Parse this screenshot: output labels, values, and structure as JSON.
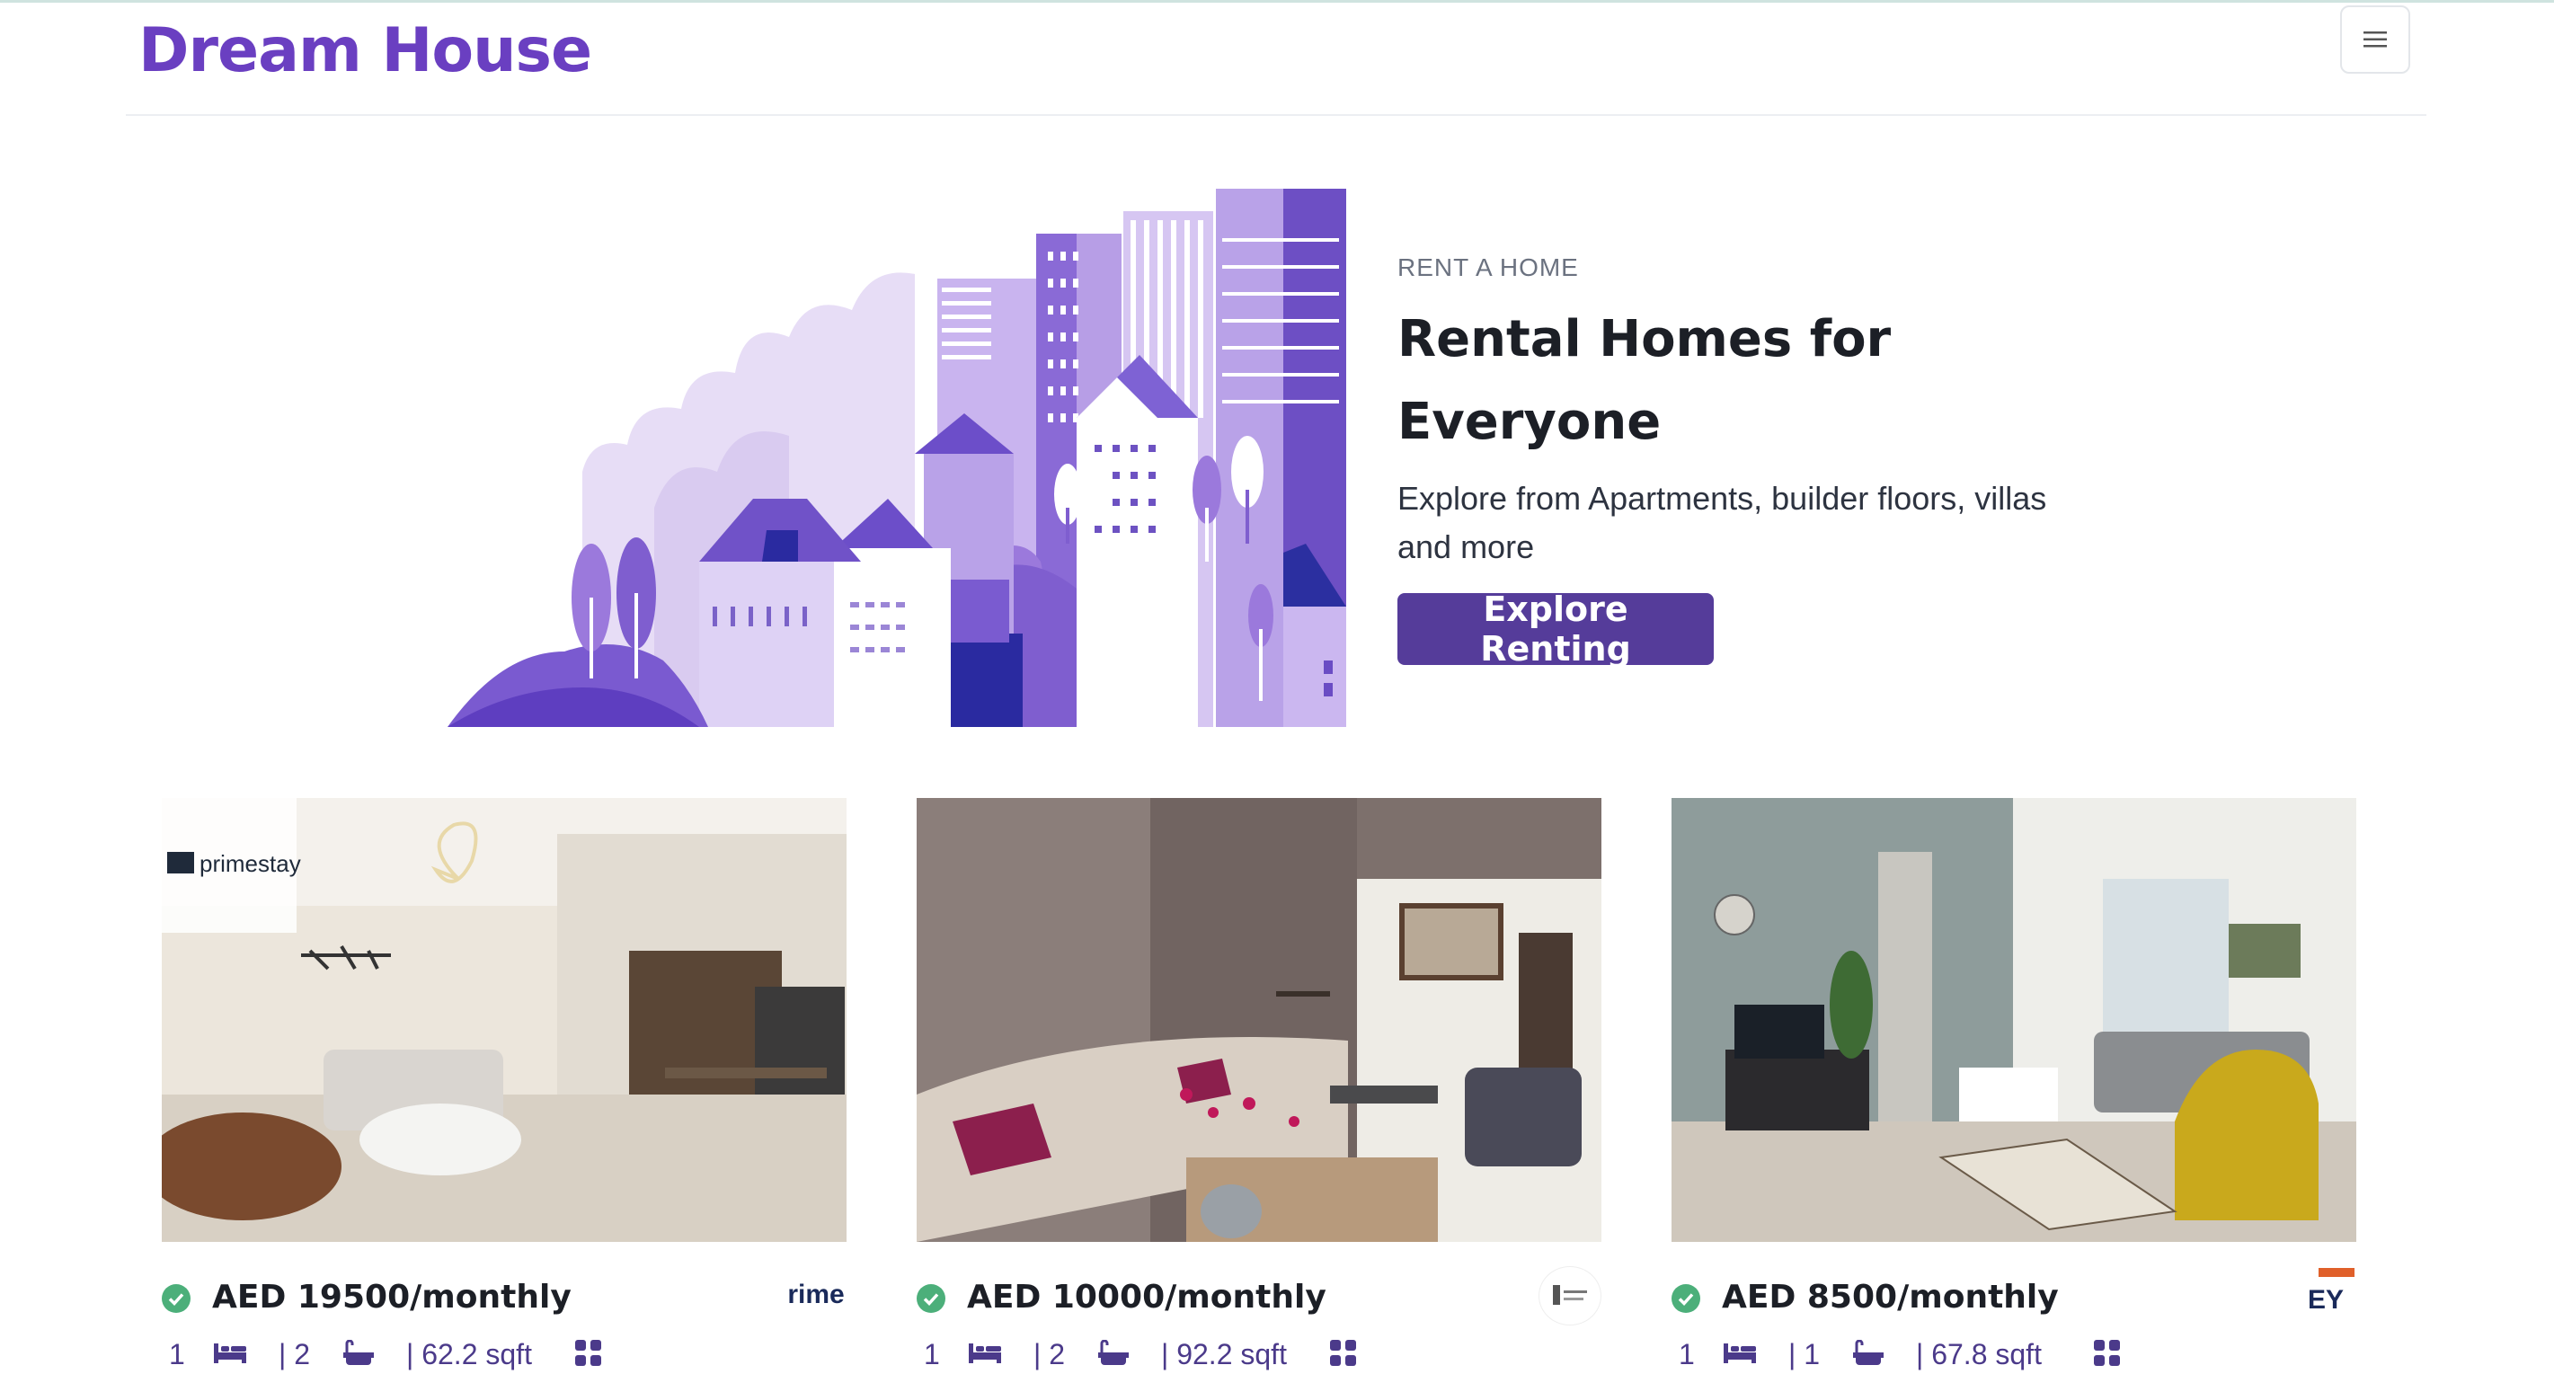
{
  "brand": "Dream House",
  "menu_icon": "hamburger-icon",
  "hero": {
    "eyebrow": "RENT A HOME",
    "title_line1": "Rental Homes for",
    "title_line2": "Everyone",
    "subtitle": "Explore from Apartments, builder floors, villas and more",
    "cta": "Explore Renting"
  },
  "colors": {
    "brand": "#6a3fc1",
    "cta": "#553c9a",
    "verified": "#4caf7a",
    "spec": "#4b3a8a"
  },
  "listings": [
    {
      "price": "AED 19500/monthly",
      "agent_logo_text": "rime",
      "photo_watermark": "primestay",
      "beds": "1",
      "baths": "| 2",
      "area": "| 62.2 sqft"
    },
    {
      "price": "AED 10000/monthly",
      "agent_logo_text": "",
      "photo_watermark": "",
      "beds": "1",
      "baths": "| 2",
      "area": "| 92.2 sqft"
    },
    {
      "price": "AED 8500/monthly",
      "agent_logo_text": "EY",
      "photo_watermark": "",
      "beds": "1",
      "baths": "| 1",
      "area": "| 67.8 sqft"
    }
  ]
}
